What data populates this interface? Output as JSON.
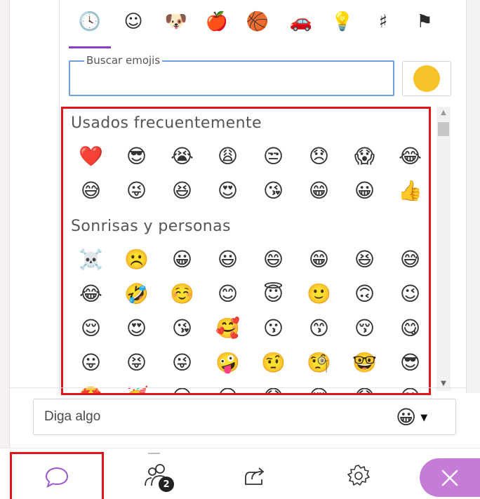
{
  "category_tabs": [
    {
      "name": "recent",
      "icon": "clock-icon",
      "glyph": "🕓",
      "active": true
    },
    {
      "name": "smileys",
      "icon": "smiley-icon",
      "glyph": "☺",
      "active": false
    },
    {
      "name": "animals",
      "icon": "dog-icon",
      "glyph": "🐶",
      "active": false
    },
    {
      "name": "food",
      "icon": "apple-icon",
      "glyph": "🍎",
      "active": false
    },
    {
      "name": "activities",
      "icon": "basketball-icon",
      "glyph": "🏀",
      "active": false
    },
    {
      "name": "travel",
      "icon": "car-icon",
      "glyph": "🚗",
      "active": false
    },
    {
      "name": "objects",
      "icon": "lightbulb-icon",
      "glyph": "💡",
      "active": false
    },
    {
      "name": "symbols",
      "icon": "symbols-icon",
      "glyph": "♯",
      "active": false
    },
    {
      "name": "flags",
      "icon": "flag-icon",
      "glyph": "⚑",
      "active": false
    }
  ],
  "search": {
    "legend": "Buscar emojis",
    "value": ""
  },
  "skin_tone": {
    "color": "#f8c22b"
  },
  "sections": [
    {
      "title": "Usados frecuentemente",
      "emojis": [
        "❤️",
        "😎",
        "😭",
        "😩",
        "😒",
        "😞",
        "😱",
        "😂",
        "😅",
        "😜",
        "😆",
        "😍",
        "😘",
        "😁",
        "😀",
        "👍"
      ]
    },
    {
      "title": "Sonrisas y personas",
      "emojis": [
        "☠️",
        "☹️",
        "😀",
        "😃",
        "😄",
        "😁",
        "😆",
        "😅",
        "😂",
        "🤣",
        "☺️",
        "😊",
        "😇",
        "🙂",
        "🙃",
        "😉",
        "😌",
        "😍",
        "😘",
        "🥰",
        "😗",
        "😙",
        "😚",
        "😋",
        "😛",
        "😝",
        "😜",
        "🤪",
        "🤨",
        "🧐",
        "🤓",
        "😎",
        "🤩",
        "🥳",
        "😏",
        "😒",
        "😞",
        "😔",
        "😟",
        "😕"
      ]
    }
  ],
  "message": {
    "placeholder": "Diga algo",
    "emoji_button": "😀",
    "caret": "▼"
  },
  "bottom_nav": {
    "chat_icon": "chat-bubble-icon",
    "attendees_badge": "2",
    "share_icon": "share-icon",
    "settings_icon": "gear-icon",
    "close_icon": "close-icon"
  },
  "colors": {
    "accent": "#8a3fc9",
    "highlight_border": "#e0151b",
    "close_button": "#c47cd6",
    "search_border": "#6ba0d8"
  }
}
